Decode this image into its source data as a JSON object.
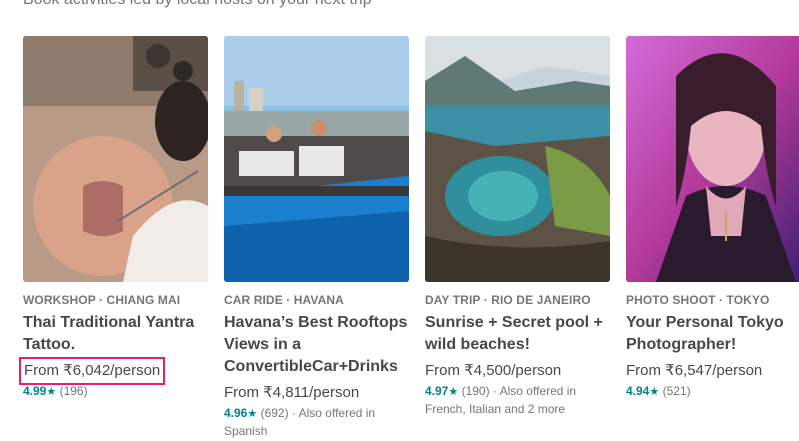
{
  "page": {
    "subtitle": "Book activities led by local hosts on your next trip"
  },
  "cards": [
    {
      "kicker": "WORKSHOP · CHIANG MAI",
      "title": "Thai Traditional Yantra Tattoo.",
      "price": "From ₹6,042/person",
      "rating": "4.99",
      "reviews": "(196)",
      "extra": ""
    },
    {
      "kicker": "CAR RIDE · HAVANA",
      "title": "Havana’s Best Rooftops Views in a ConvertibleCar+Drinks",
      "price": "From ₹4,811/person",
      "rating": "4.96",
      "reviews": "(692)",
      "extra": "· Also offered in Spanish"
    },
    {
      "kicker": "DAY TRIP · RIO DE JANEIRO",
      "title": "Sunrise + Secret pool + wild beaches!",
      "price": "From ₹4,500/person",
      "rating": "4.97",
      "reviews": "(190)",
      "extra": "· Also offered in French, Italian and 2 more"
    },
    {
      "kicker": "PHOTO SHOOT · TOKYO",
      "title": "Your Personal Tokyo Photographer!",
      "price": "From ₹6,547/person",
      "rating": "4.94",
      "reviews": "(521)",
      "extra": ""
    }
  ],
  "icons": {
    "star": "★"
  },
  "colors": {
    "rating": "#008489",
    "highlight": "#e91e63",
    "text": "#484848",
    "muted": "#767676"
  }
}
